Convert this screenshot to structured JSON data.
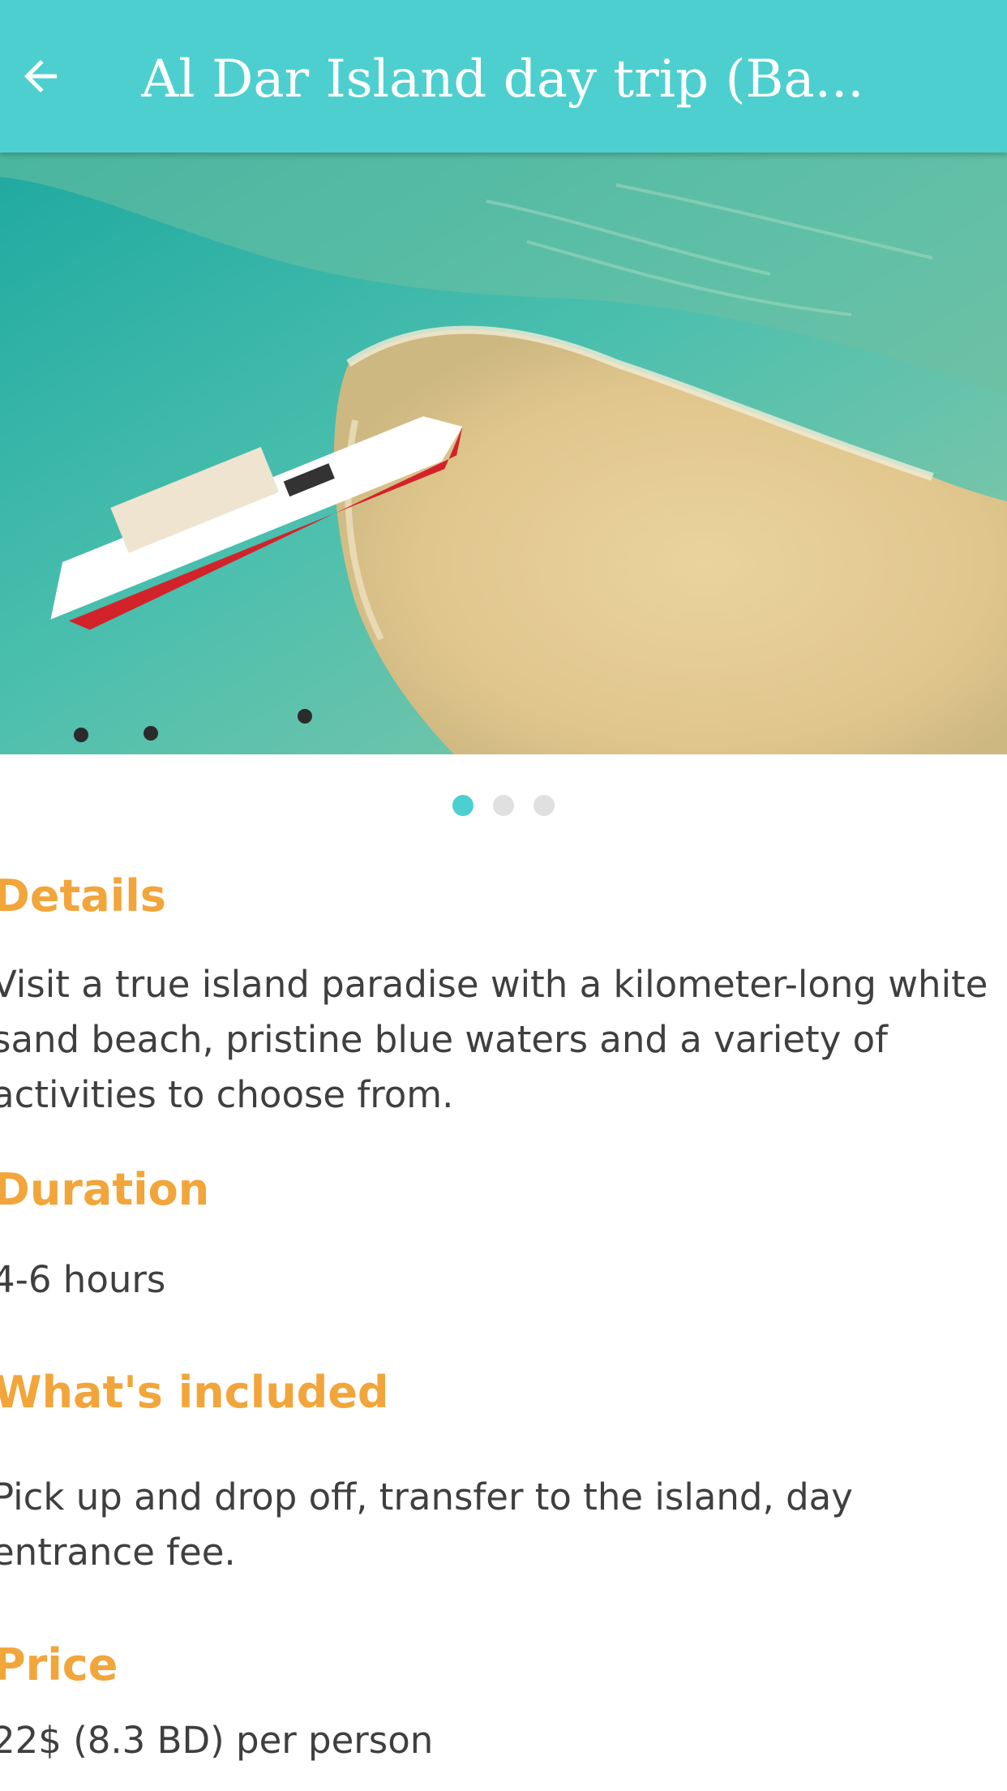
{
  "header": {
    "title": "Al Dar Island day trip (Ba...",
    "back_icon": "arrow-left-icon",
    "background_color": "#4dcfcf"
  },
  "gallery": {
    "image_description_icon": "island-boat-photo",
    "page_count": 3,
    "active_index": 0
  },
  "sections": {
    "details": {
      "heading": "Details",
      "text": "Visit a true island paradise with a kilometer-long white sand beach, pristine blue waters and a variety of activities to choose from."
    },
    "duration": {
      "heading": "Duration",
      "text": "4-6 hours"
    },
    "included": {
      "heading": "What's included",
      "text": "Pick up and drop off, transfer to the island, day entrance fee."
    },
    "price": {
      "heading": "Price",
      "text": "22$ (8.3 BD) per person"
    }
  },
  "colors": {
    "accent": "#4dcfcf",
    "heading": "#f2a53a",
    "body_text": "#3f3f3f"
  }
}
